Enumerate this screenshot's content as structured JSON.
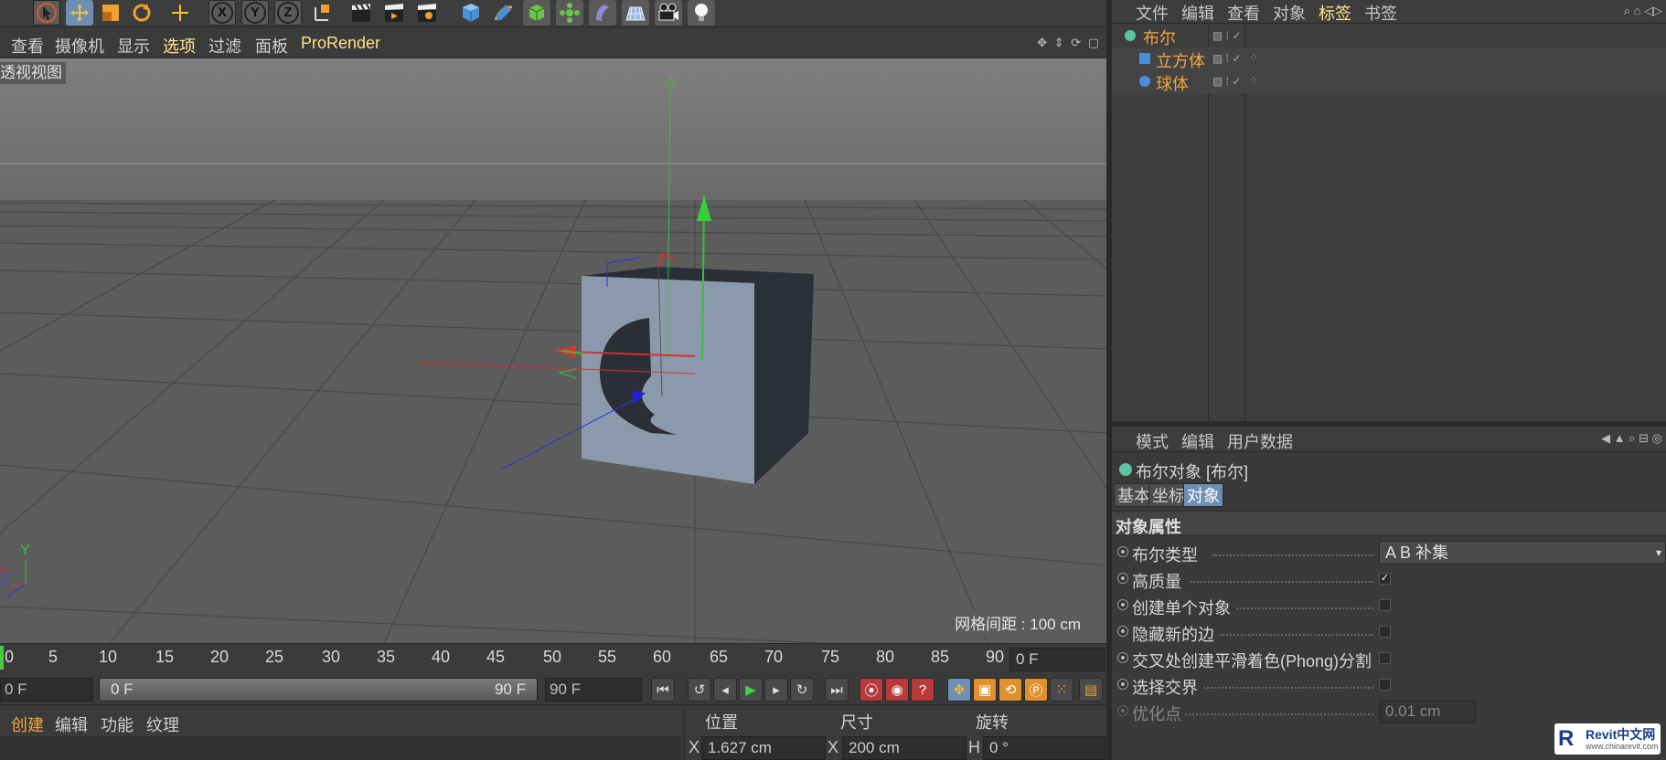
{
  "viewport": {
    "menu": [
      "查看",
      "摄像机",
      "显示",
      "选项",
      "过滤",
      "面板",
      "ProRender"
    ],
    "camera_label": "透视视图",
    "grid_spacing": "网格间距 : 100 cm",
    "axis_y": "Y",
    "axis_x": "X",
    "axis_z": "Z"
  },
  "timeline": {
    "ticks": [
      "0",
      "5",
      "10",
      "15",
      "20",
      "25",
      "30",
      "35",
      "40",
      "45",
      "50",
      "55",
      "60",
      "65",
      "70",
      "75",
      "80",
      "85",
      "90"
    ],
    "current_frame": "0 F"
  },
  "transport": {
    "start_frame": "0 F",
    "range_start": "0 F",
    "range_end": "90 F",
    "end_frame": "90 F"
  },
  "material_menu": [
    "创建",
    "编辑",
    "功能",
    "纹理"
  ],
  "coordinates": {
    "headers": [
      "位置",
      "尺寸",
      "旋转"
    ],
    "pos_axis": "X",
    "pos_value": "1.627 cm",
    "size_axis": "X",
    "size_value": "200 cm",
    "rot_axis": "H",
    "rot_value": "0 °"
  },
  "object_manager": {
    "menu": [
      "文件",
      "编辑",
      "查看",
      "对象",
      "标签",
      "书签"
    ],
    "objects": [
      {
        "name": "布尔",
        "level": 0
      },
      {
        "name": "立方体",
        "level": 1
      },
      {
        "name": "球体",
        "level": 1
      }
    ]
  },
  "attribute_manager": {
    "menu": [
      "模式",
      "编辑",
      "用户数据"
    ],
    "title": "布尔对象 [布尔]",
    "tabs": [
      "基本",
      "坐标",
      "对象"
    ],
    "active_tab": "对象",
    "section": "对象属性",
    "props": [
      {
        "label": "布尔类型",
        "type": "select",
        "value": "A B 补集"
      },
      {
        "label": "高质量",
        "type": "check",
        "checked": true
      },
      {
        "label": "创建单个对象",
        "type": "check",
        "checked": false
      },
      {
        "label": "隐藏新的边",
        "type": "check",
        "checked": false
      },
      {
        "label": "交叉处创建平滑着色(Phong)分割",
        "type": "check",
        "checked": false
      },
      {
        "label": "选择交界",
        "type": "check",
        "checked": false
      },
      {
        "label": "优化点",
        "type": "num",
        "value": "0.01 cm"
      }
    ]
  },
  "watermark": {
    "logo": "R",
    "line1": "Revit中文网",
    "line2": "www.chinarevit.com"
  },
  "colors": {
    "accent": "#f0a53c",
    "highlight": "#ffe58f",
    "active_tab": "#6e8fb5"
  }
}
